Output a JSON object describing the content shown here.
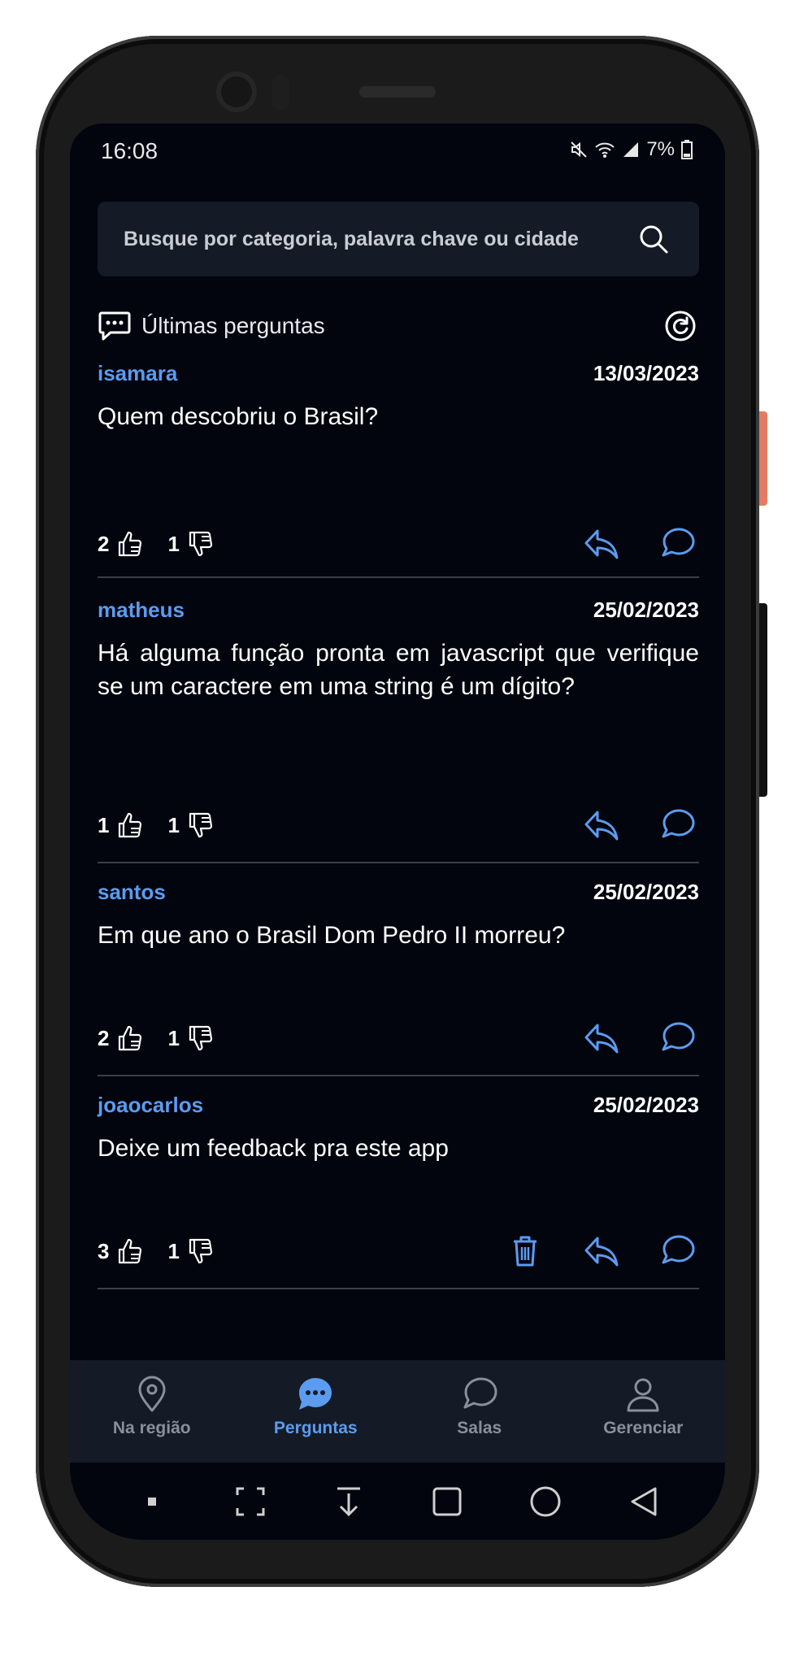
{
  "status_bar": {
    "time": "16:08",
    "battery": "7%"
  },
  "search": {
    "placeholder": "Busque por categoria, palavra chave ou cidade"
  },
  "section": {
    "title": "Últimas perguntas"
  },
  "questions": [
    {
      "user": "isamara",
      "date": "13/03/2023",
      "text": "Quem descobriu o Brasil?",
      "likes": "2",
      "dislikes": "1"
    },
    {
      "user": "matheus",
      "date": "25/02/2023",
      "text": "Há alguma função pronta em javascript que verifique se um caractere em uma string é um dígito?",
      "likes": "1",
      "dislikes": "1"
    },
    {
      "user": "santos",
      "date": "25/02/2023",
      "text": "Em que ano o Brasil Dom Pedro II morreu?",
      "likes": "2",
      "dislikes": "1"
    },
    {
      "user": "joaocarlos",
      "date": "25/02/2023",
      "text": "Deixe um feedback pra este app",
      "likes": "3",
      "dislikes": "1"
    }
  ],
  "nav": {
    "items": [
      {
        "label": "Na região",
        "icon": "location-pin-icon"
      },
      {
        "label": "Perguntas",
        "icon": "chat-bubble-icon"
      },
      {
        "label": "Salas",
        "icon": "rooms-chat-icon"
      },
      {
        "label": "Gerenciar",
        "icon": "user-icon"
      }
    ],
    "active": "Perguntas"
  },
  "colors": {
    "accent": "#5b9cf0",
    "background": "#02040e",
    "surface": "#141b26"
  }
}
